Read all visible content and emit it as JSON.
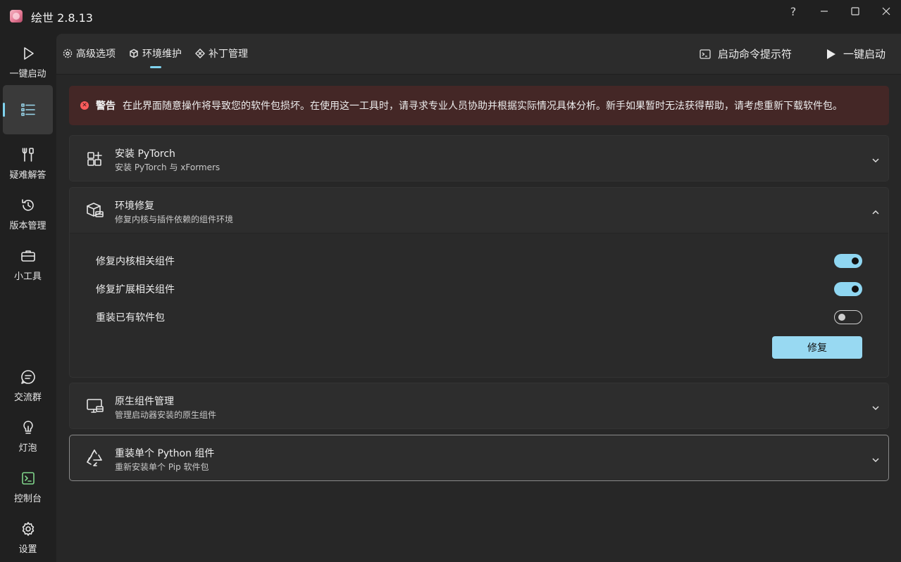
{
  "app": {
    "title": "绘世 2.8.13"
  },
  "window_controls": {
    "help": "?"
  },
  "sidebar": {
    "items": [
      {
        "label": "一键启动",
        "icon": "play-icon"
      },
      {
        "label": "",
        "icon": "list-icon"
      },
      {
        "label": "疑难解答",
        "icon": "tools-icon"
      },
      {
        "label": "版本管理",
        "icon": "history-icon"
      },
      {
        "label": "小工具",
        "icon": "toolbox-icon"
      },
      {
        "label": "交流群",
        "icon": "chat-icon"
      },
      {
        "label": "灯泡",
        "icon": "lightbulb-icon"
      },
      {
        "label": "控制台",
        "icon": "console-icon"
      },
      {
        "label": "设置",
        "icon": "gear-icon"
      }
    ]
  },
  "toolbar": {
    "tabs": [
      {
        "label": "高级选项",
        "icon": "gear-icon"
      },
      {
        "label": "环境维护",
        "icon": "package-icon",
        "selected": true
      },
      {
        "label": "补丁管理",
        "icon": "patch-icon"
      }
    ],
    "cmd_label": "启动命令提示符",
    "launch_label": "一键启动"
  },
  "warning": {
    "title": "警告",
    "text": "在此界面随意操作将导致您的软件包损坏。在使用这一工具时，请寻求专业人员协助并根据实际情况具体分析。新手如果暂时无法获得帮助，请考虑重新下载软件包。"
  },
  "cards": [
    {
      "title": "安装 PyTorch",
      "subtitle": "安装 PyTorch 与 xFormers",
      "expanded": false
    },
    {
      "title": "环境修复",
      "subtitle": "修复内核与插件依赖的组件环境",
      "expanded": true,
      "options": [
        {
          "label": "修复内核相关组件",
          "on": true
        },
        {
          "label": "修复扩展相关组件",
          "on": true
        },
        {
          "label": "重装已有软件包",
          "on": false
        }
      ],
      "button": "修复"
    },
    {
      "title": "原生组件管理",
      "subtitle": "管理启动器安装的原生组件",
      "expanded": false
    },
    {
      "title": "重装单个 Python 组件",
      "subtitle": "重新安装单个 Pip 软件包",
      "expanded": false
    }
  ],
  "colors": {
    "accent": "#7fd3ef",
    "toggle_on": "#8fd6f1",
    "button": "#98d9f2",
    "warning_bg": "#442726",
    "warning_icon": "#ff5c5c"
  }
}
